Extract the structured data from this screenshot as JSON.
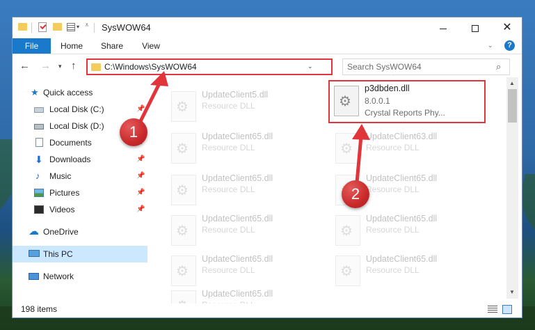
{
  "window": {
    "title": "SysWOW64",
    "controls": {
      "minimize": "minimize-icon",
      "maximize": "maximize-icon",
      "close": "close-icon"
    }
  },
  "ribbon": {
    "tabs": [
      "File",
      "Home",
      "Share",
      "View"
    ],
    "help": "?"
  },
  "nav": {
    "address": "C:\\Windows\\SysWOW64",
    "search_placeholder": "Search SysWOW64"
  },
  "sidebar": {
    "items": [
      {
        "label": "Quick access",
        "icon": "star-icon",
        "pinned": false
      },
      {
        "label": "Local Disk (C:)",
        "icon": "drive-icon",
        "pinned": true
      },
      {
        "label": "Local Disk (D:)",
        "icon": "drive-icon",
        "pinned": false
      },
      {
        "label": "Documents",
        "icon": "documents-icon",
        "pinned": true
      },
      {
        "label": "Downloads",
        "icon": "download-icon",
        "pinned": true
      },
      {
        "label": "Music",
        "icon": "music-icon",
        "pinned": true
      },
      {
        "label": "Pictures",
        "icon": "pictures-icon",
        "pinned": true
      },
      {
        "label": "Videos",
        "icon": "videos-icon",
        "pinned": true
      },
      {
        "label": "OneDrive",
        "icon": "cloud-icon",
        "pinned": false
      },
      {
        "label": "This PC",
        "icon": "computer-icon",
        "pinned": false,
        "selected": true
      },
      {
        "label": "Network",
        "icon": "network-icon",
        "pinned": false
      }
    ]
  },
  "files": {
    "highlighted": {
      "name": "p3dbden.dll",
      "version": "8.0.0.1",
      "description": "Crystal Reports Phy..."
    },
    "left_column": [
      {
        "name": "UpdateClient5.dll",
        "type": "Resource DLL"
      },
      {
        "name": "UpdateClient65.dll",
        "type": "Resource DLL"
      },
      {
        "name": "UpdateClient65.dll",
        "type": "Resource DLL"
      },
      {
        "name": "UpdateClient65.dll",
        "type": "Resource DLL"
      },
      {
        "name": "UpdateClient65.dll",
        "type": "Resource DLL"
      },
      {
        "name": "UpdateClient65.dll",
        "type": "Resource DLL"
      }
    ],
    "right_column": [
      {
        "name": "UpdateClient63.dll",
        "type": "Resource DLL"
      },
      {
        "name": "UpdateClient65.dll",
        "type": "Resource DLL"
      },
      {
        "name": "UpdateClient65.dll",
        "type": "Resource DLL"
      },
      {
        "name": "UpdateClient65.dll",
        "type": "Resource DLL"
      }
    ]
  },
  "status": {
    "items": "198 items"
  },
  "annotations": {
    "step1": "1",
    "step2": "2",
    "color": "#e0353b"
  }
}
